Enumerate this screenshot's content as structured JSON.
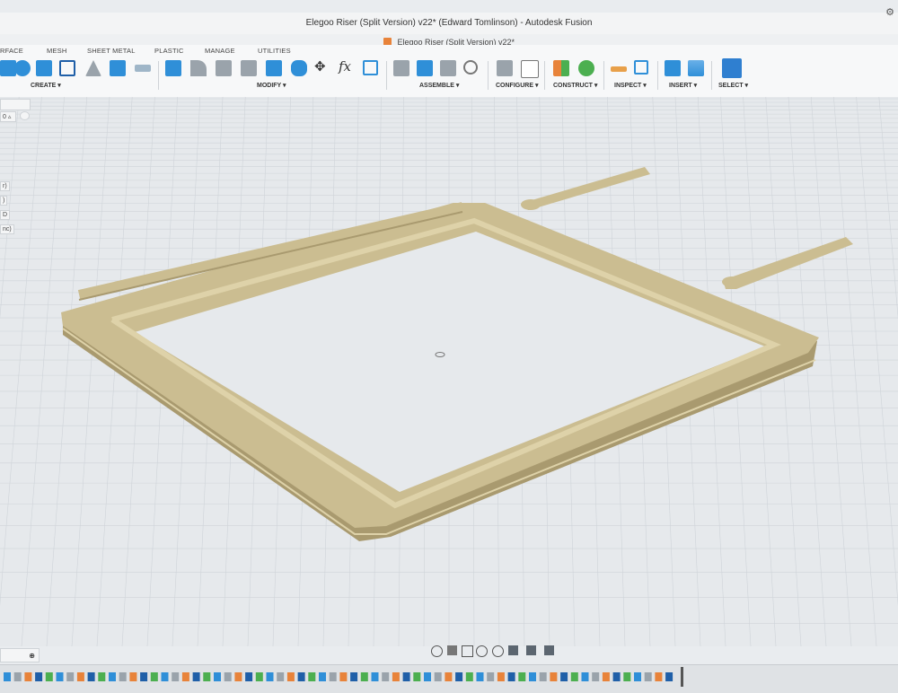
{
  "window": {
    "title": "Elegoo Riser (Split Version) v22* (Edward Tomlinson) - Autodesk Fusion",
    "doc_tab": "Elegoo Riser (Split Version) v22*"
  },
  "toolbar": {
    "tabs": [
      "RFACE",
      "MESH",
      "SHEET METAL",
      "PLASTIC",
      "MANAGE",
      "UTILITIES"
    ],
    "groups": {
      "create": "CREATE ▾",
      "modify": "MODIFY ▾",
      "assemble": "ASSEMBLE ▾",
      "configure": "CONFIGURE ▾",
      "construct": "CONSTRUCT ▾",
      "inspect": "INSPECT ▾",
      "insert": "INSERT ▾",
      "select": "SELECT ▾"
    }
  },
  "browser_panel": {
    "rows": [
      "r)",
      ")",
      "D",
      "nc)"
    ],
    "field_value": "0 ▵"
  },
  "model": {
    "color": "#cbbd91",
    "color_dark": "#a99a6f",
    "color_light": "#ded2a9"
  },
  "viewport": {
    "background": "#e6e9ec",
    "grid_color": "#cfd4d9"
  },
  "icons": {
    "corner": "settings-icon",
    "fx": "fx"
  },
  "comments_badge": "⊕"
}
